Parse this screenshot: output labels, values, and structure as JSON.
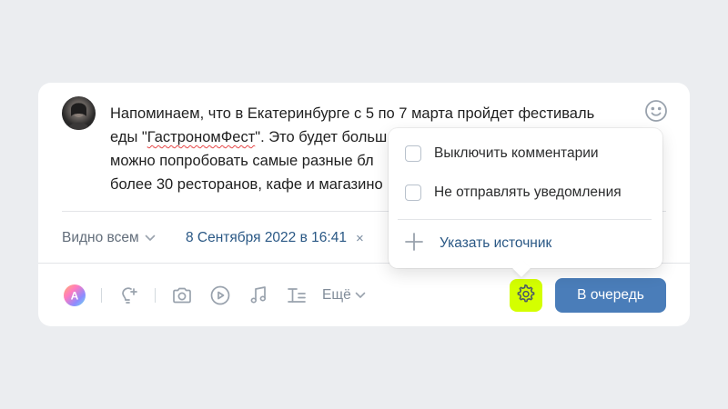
{
  "post": {
    "text_before": "Напоминаем, что в Екатеринбурге с 5 по 7 марта пройдет фестиваль\nеды \"",
    "text_highlight": "ГастрономФест",
    "text_after": "\". Это будет больш\nможно попробовать самые разные бл\nболее 30 ресторанов, кафе и магазино"
  },
  "meta": {
    "visibility_label": "Видно всем",
    "date_label": "8 Сентября 2022 в 16:41",
    "clear_symbol": "×"
  },
  "toolbar": {
    "more_label": "Ещё",
    "icons": [
      "avatar-gradient-icon",
      "lightbulb-icon",
      "camera-icon",
      "play-icon",
      "music-icon",
      "text-format-icon",
      "gear-icon"
    ]
  },
  "submit": {
    "label": "В очередь"
  },
  "dropdown": {
    "items": [
      {
        "label": "Выключить комментарии",
        "checked": false
      },
      {
        "label": "Не отправлять уведомления",
        "checked": false
      }
    ],
    "source_label": "Указать источник"
  },
  "colors": {
    "background": "#ebedf0",
    "accent_blue": "#4a7db9",
    "link_blue": "#2a5885",
    "gear_highlight": "#d4ff00"
  }
}
